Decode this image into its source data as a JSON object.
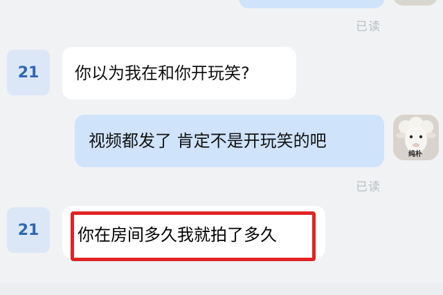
{
  "messages": [
    {
      "side": "out",
      "text": "",
      "status": "已读"
    },
    {
      "side": "in",
      "sender": "21",
      "text": "你以为我在和你开玩笑?"
    },
    {
      "side": "out",
      "text": "视频都发了 肯定不是开玩笑的吧",
      "status": "已读",
      "avatar_caption": "纯朴"
    },
    {
      "side": "in",
      "sender": "21",
      "text": "你在房间多久我就拍了多久",
      "highlighted": true
    }
  ],
  "colors": {
    "background": "#f1f2f4",
    "outgoing_bubble": "#cfe3fb",
    "incoming_bubble": "#ffffff",
    "highlight_border": "#e02424",
    "read_status": "#b8bdc4",
    "avatar_number": "#2f66b3"
  },
  "icons": [
    "sheep-avatar"
  ]
}
